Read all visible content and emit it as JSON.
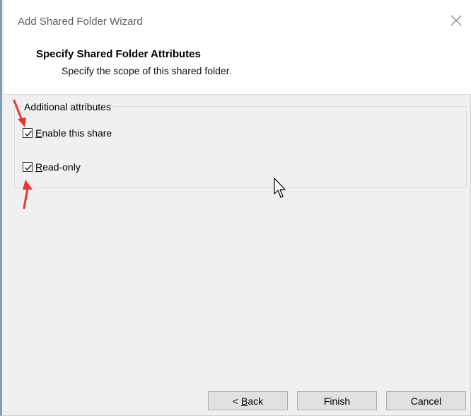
{
  "window": {
    "title": "Add Shared Folder Wizard"
  },
  "header": {
    "title": "Specify Shared Folder Attributes",
    "subtitle": "Specify the scope of this shared folder."
  },
  "group": {
    "legend": "Additional attributes",
    "options": [
      {
        "label_pre": "",
        "label_mnemonic": "E",
        "label_post": "nable this share",
        "checked": true
      },
      {
        "label_pre": "",
        "label_mnemonic": "R",
        "label_post": "ead-only",
        "checked": true
      }
    ]
  },
  "buttons": {
    "back_pre": "< ",
    "back_mnemonic": "B",
    "back_post": "ack",
    "finish": "Finish",
    "cancel": "Cancel"
  },
  "icons": {
    "close": "close-icon",
    "checkmark": "checkmark-icon",
    "annotation_arrow": "red-arrow-icon",
    "cursor": "mouse-pointer-icon"
  },
  "colors": {
    "annotation": "#e53935",
    "button_border": "#adadad",
    "button_default_border": "#0078d7"
  }
}
